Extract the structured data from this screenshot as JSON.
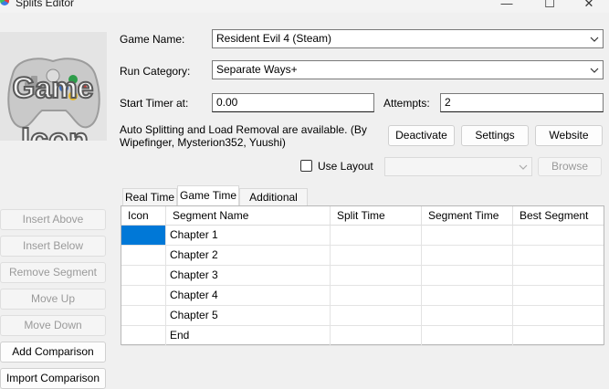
{
  "window": {
    "title": "Splits Editor",
    "controls": {
      "minimize": "—",
      "maximize": "☐",
      "close": "✕"
    }
  },
  "game_icon": {
    "line1": "Game",
    "line2": "Icon"
  },
  "form": {
    "game_name_label": "Game Name:",
    "game_name_value": "Resident Evil 4 (Steam)",
    "run_category_label": "Run Category:",
    "run_category_value": "Separate Ways+",
    "start_timer_label": "Start Timer at:",
    "start_timer_value": "0.00",
    "attempts_label": "Attempts:",
    "attempts_value": "2",
    "autosplit_text": "Auto Splitting and Load Removal are available. (By Wipefinger, Mysterion352, Yuushi)",
    "deactivate_label": "Deactivate",
    "settings_label": "Settings",
    "website_label": "Website",
    "use_layout_label": "Use Layout",
    "use_layout_checked": false,
    "layout_value": "",
    "browse_label": "Browse"
  },
  "side_buttons": [
    {
      "label": "Insert Above",
      "enabled": false
    },
    {
      "label": "Insert Below",
      "enabled": false
    },
    {
      "label": "Remove Segment",
      "enabled": false
    },
    {
      "label": "Move Up",
      "enabled": false
    },
    {
      "label": "Move Down",
      "enabled": false
    },
    {
      "label": "Add Comparison",
      "enabled": true
    },
    {
      "label": "Import Comparison",
      "enabled": true
    }
  ],
  "tabs": [
    {
      "label": "Real Time",
      "active": false
    },
    {
      "label": "Game Time",
      "active": true
    },
    {
      "label": "Additional Info",
      "active": false
    }
  ],
  "grid": {
    "columns": [
      "Icon",
      "Segment Name",
      "Split Time",
      "Segment Time",
      "Best Segment"
    ],
    "rows": [
      {
        "name": "Chapter 1",
        "split": "",
        "segment": "",
        "best": "",
        "selected": true
      },
      {
        "name": "Chapter 2",
        "split": "",
        "segment": "",
        "best": ""
      },
      {
        "name": "Chapter 3",
        "split": "",
        "segment": "",
        "best": ""
      },
      {
        "name": "Chapter 4",
        "split": "",
        "segment": "",
        "best": ""
      },
      {
        "name": "Chapter 5",
        "split": "",
        "segment": "",
        "best": ""
      },
      {
        "name": "End",
        "split": "",
        "segment": "",
        "best": ""
      }
    ]
  },
  "colors": {
    "selection": "#0078d7",
    "window_bg": "#f0f0f0"
  }
}
